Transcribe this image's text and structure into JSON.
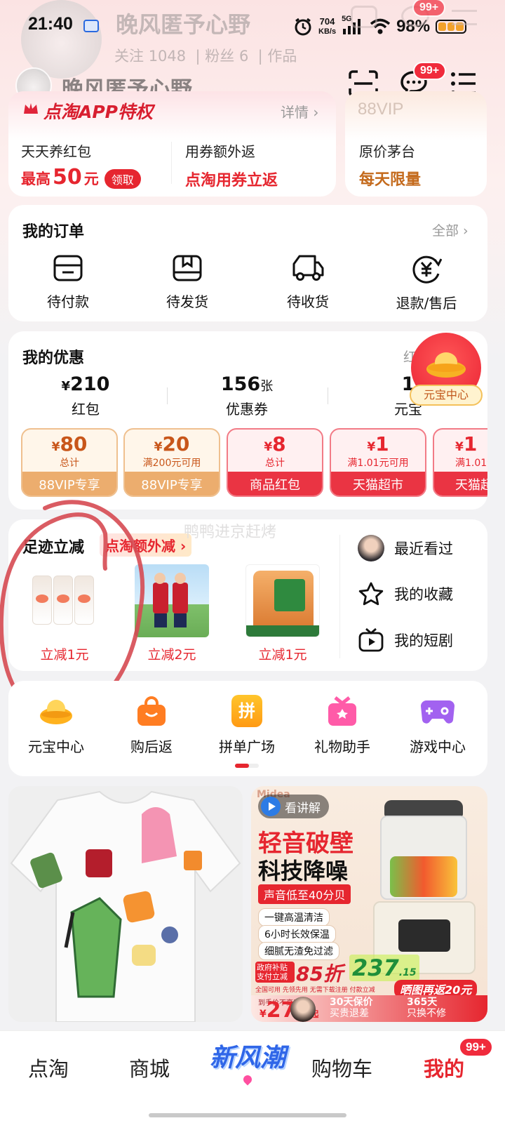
{
  "status": {
    "time": "21:40",
    "speed_value": "704",
    "speed_unit": "KB/s",
    "network": "5G",
    "battery": "98%"
  },
  "profile": {
    "name": "晚风匿予心野",
    "follow_label": "关注",
    "follow_count": "1048",
    "fans_label": "粉丝",
    "fans_count": "6",
    "works_label": "作品"
  },
  "header": {
    "message_badge": "99+",
    "ghost_badge": "99+"
  },
  "vip": {
    "title": "点淘APP特权",
    "detail_link": "详情",
    "items": [
      {
        "label": "天天养红包",
        "value_prefix": "最高",
        "value_num": "50",
        "value_unit": "元",
        "button": "领取"
      },
      {
        "label": "用券额外返",
        "value": "点淘用券立返"
      }
    ],
    "vip88": {
      "title": "88VIP",
      "label": "原价茅台",
      "value": "每天限量"
    }
  },
  "orders": {
    "title": "我的订单",
    "all_link": "全部",
    "items": [
      {
        "icon": "wallet-icon",
        "label": "待付款"
      },
      {
        "icon": "box-icon",
        "label": "待发货"
      },
      {
        "icon": "truck-icon",
        "label": "待收货"
      },
      {
        "icon": "refund-icon",
        "label": "退款/售后"
      }
    ]
  },
  "benefits": {
    "title": "我的优惠",
    "partial_link": "红",
    "stats": [
      {
        "prefix": "¥",
        "value": "210",
        "suffix": "",
        "label": "红包"
      },
      {
        "prefix": "",
        "value": "156",
        "suffix": "张",
        "label": "优惠券"
      },
      {
        "prefix": "",
        "value": "1",
        "suffix": "",
        "label": "元宝"
      }
    ],
    "yuanbao_float": "元宝中心",
    "coupons": [
      {
        "amount": "80",
        "desc": "总计",
        "tag": "88VIP专享"
      },
      {
        "amount": "20",
        "desc": "满200元可用",
        "tag": "88VIP专享"
      },
      {
        "amount": "8",
        "desc": "总计",
        "tag": "商品红包"
      },
      {
        "amount": "1",
        "desc": "满1.01元可用",
        "tag": "天猫超市"
      },
      {
        "amount": "1",
        "desc": "满1.01元",
        "tag": "天猫超"
      }
    ]
  },
  "footprint": {
    "title": "足迹立减",
    "subtitle": "点淘额外减",
    "watermark": "鸭鸭进京赶烤",
    "products": [
      {
        "discount": "立减1元"
      },
      {
        "discount": "立减2元"
      },
      {
        "discount": "立减1元"
      }
    ],
    "links": [
      {
        "icon": "avatar-icon",
        "label": "最近看过"
      },
      {
        "icon": "star-icon",
        "label": "我的收藏"
      },
      {
        "icon": "tv-icon",
        "label": "我的短剧"
      }
    ]
  },
  "services": [
    {
      "icon": "ingot-icon",
      "label": "元宝中心",
      "color": "#ffb21e"
    },
    {
      "icon": "bag-icon",
      "label": "购后返",
      "color": "#ff7d22"
    },
    {
      "icon": "pin-icon",
      "label": "拼单广场",
      "color": "#ffae1a",
      "glyph": "拼"
    },
    {
      "icon": "gift-icon",
      "label": "礼物助手",
      "color": "#ff5ba8"
    },
    {
      "icon": "gamepad-icon",
      "label": "游戏中心",
      "color": "#a262f0"
    }
  ],
  "feed": {
    "ad": {
      "brand": "Midea",
      "explain": "看讲解",
      "headline1": "轻音破壁",
      "headline2": "科技降噪",
      "noise_tag": "声音低至40分贝",
      "features": [
        "一键高温清洁",
        "6小时长效保温",
        "细腻无渣免过滤"
      ],
      "subsidy": "政府补贴 支付立减",
      "discount": "85折",
      "price": "237",
      "price_decimal": ".15",
      "promo_row": "全国可用 先领先用 无需下载注册 付款立减",
      "return_tag": "晒图再返20元",
      "guarantee": "30天保价",
      "guarantee_sub": "买贵退差",
      "replace": "365天",
      "replace_sub": "只换不修",
      "price_prefix": "到手价不高于:",
      "big_price": "279",
      "price_suffix": "起"
    }
  },
  "bottom_nav": [
    {
      "label": "点淘"
    },
    {
      "label": "商城"
    },
    {
      "label": "新风潮"
    },
    {
      "label": "购物车"
    },
    {
      "label": "我的",
      "badge": "99+"
    }
  ],
  "colors": {
    "accent": "#e6262f",
    "gold": "#f2a93b"
  }
}
